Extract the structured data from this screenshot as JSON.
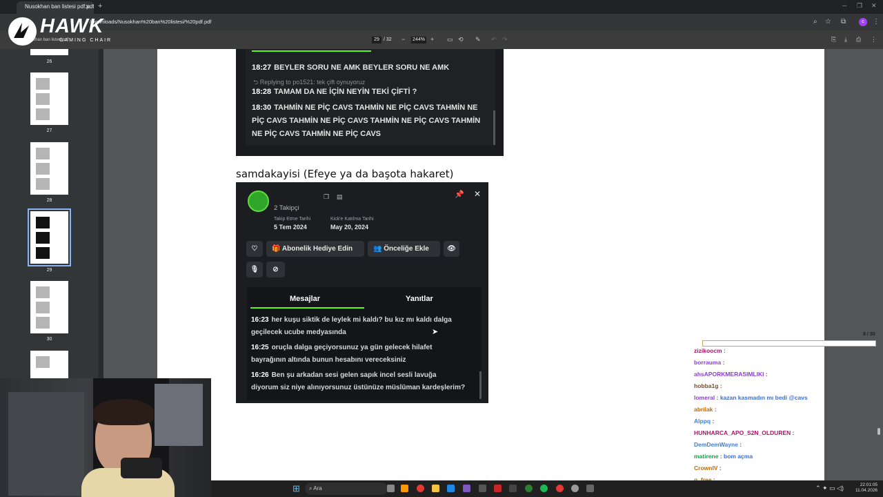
{
  "browser": {
    "tab_title": "Nusokhan ban listesi pdf.pdf",
    "url": "/Downloads/Nusokhan%20ban%20listesi/%20pdf.pdf"
  },
  "pdf_toolbar": {
    "current_page": "29",
    "total_pages": "/ 32",
    "zoom": "244%"
  },
  "watermark": {
    "brand": "HAWK",
    "sub": "GAMING CHAIR",
    "partial_title": "khan ban listesi pdf"
  },
  "sidebar": {
    "thumbnails": [
      {
        "label": "26"
      },
      {
        "label": "27"
      },
      {
        "label": "28"
      },
      {
        "label": "29",
        "selected": true
      },
      {
        "label": "30"
      }
    ]
  },
  "chat1": {
    "messages": [
      {
        "time": "18:27",
        "text": "BEYLER SORU NE AMK BEYLER SORU NE AMK"
      },
      {
        "reply": "Replying to po1521: tek çift oynuyoruz"
      },
      {
        "time": "18:28",
        "text": "TAMAM DA NE İÇİN NEYİN TEKİ ÇİFTİ ?"
      },
      {
        "time": "18:30",
        "text": "TAHMİN NE PİÇ CAVS TAHMİN NE PİÇ CAVS TAHMİN NE"
      },
      {
        "text": "PİÇ CAVS TAHMİN NE PİÇ CAVS TAHMİN NE PİÇ CAVS TAHMİN"
      },
      {
        "text": "NE PİÇ CAVS TAHMİN NE PİÇ CAVS"
      }
    ]
  },
  "heading": "samdakayisi (Efeye ya da başota hakaret)",
  "profile_card": {
    "username": "samdakayisi",
    "followers": "2 Takipçi",
    "follow_label": "Takip Etme Tarihi",
    "follow_date": "5 Tem 2024",
    "join_label": "Kick'e Katılma Tarihi",
    "join_date": "May 20, 2024",
    "gift_button": "Abonelik Hediye Edin",
    "priority_button": "Önceliğe Ekle",
    "tab_messages": "Mesajlar",
    "tab_replies": "Yanıtlar",
    "messages": [
      {
        "time": "16:23",
        "line1": "her kuşu siktik de leylek mi kaldı? bu kız mı kaldı dalga",
        "line2": "geçilecek ucube medyasında"
      },
      {
        "time": "16:25",
        "line1": "oruçla dalga geçiyorsunuz ya gün gelecek hilafet",
        "line2": "bayrağının altında bunun hesabını vereceksiniz"
      },
      {
        "time": "16:26",
        "line1": "Ben şu arkadan sesi gelen sapık incel sesli lavuğa",
        "line2": "diyorum siz niye alınıyorsunuz üstünüze müslüman kardeşlerim?"
      }
    ]
  },
  "stream_overlay": {
    "goal_counter": "8 / 30",
    "chat": [
      {
        "user": "zizikoocm",
        "color": "#b0106a"
      },
      {
        "user": "borrauma",
        "color": "#8a3fd1"
      },
      {
        "user": "ahsAPORKMERASIMLIKI",
        "color": "#8a3fd1"
      },
      {
        "user": "hobba1g",
        "color": "#7a4a2a"
      },
      {
        "user": "lomeral",
        "color": "#8a3fd1",
        "msg": "kazan kasmadın mı bedi @cavs"
      },
      {
        "user": "abrilak",
        "color": "#c06a00"
      },
      {
        "user": "Alppq",
        "color": "#3c7fd6"
      },
      {
        "user": "HUNHARCA_APO_S2N_OLDUREN",
        "color": "#b0106a"
      },
      {
        "user": "DemDemWayne",
        "color": "#3c7fd6"
      },
      {
        "user": "matirene",
        "color": "#1b9a4a",
        "msg": "bom açma"
      },
      {
        "user": "CrownIV",
        "color": "#c06a00"
      },
      {
        "user": "g_free",
        "color": "#c06a00"
      }
    ]
  },
  "taskbar": {
    "search": "Ara",
    "time": "22:01:05",
    "date": "11.04.2026"
  }
}
